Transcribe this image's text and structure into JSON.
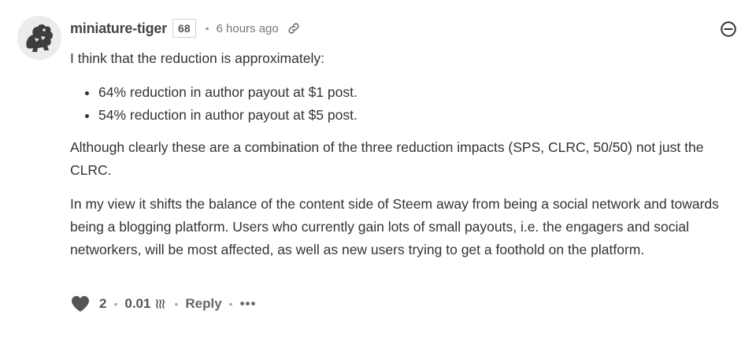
{
  "comment": {
    "author": "miniature-tiger",
    "reputation": "68",
    "timestamp": "6 hours ago",
    "body": {
      "intro": "I think that the reduction is approximately:",
      "bullets": [
        "64% reduction in author payout at $1 post.",
        "54% reduction in author payout at $5 post."
      ],
      "paragraph_1": "Although clearly these are a combination of the three reduction impacts (SPS, CLRC, 50/50) not just the CLRC.",
      "paragraph_2": "In my view it shifts the balance of the content side of Steem away from being a social network and towards being a blogging platform. Users who currently gain lots of small payouts, i.e. the engagers and social networkers, will be most affected, as well as new users trying to get a foothold on the platform."
    },
    "footer": {
      "votes": "2",
      "payout": "0.01",
      "reply_label": "Reply",
      "more_label": "•••"
    },
    "separator": "•"
  },
  "icons": {
    "avatar": "tiger-avatar",
    "link": "link-icon",
    "collapse": "minus-circle-icon",
    "upvote": "heart-icon",
    "currency": "steem-icon",
    "more": "ellipsis-icon"
  }
}
